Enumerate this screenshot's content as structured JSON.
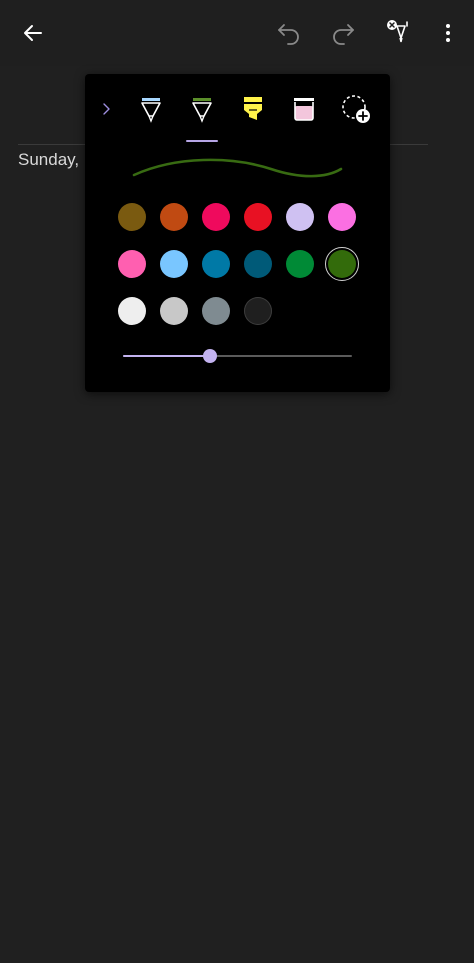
{
  "appbar": {
    "icons": [
      "back-arrow-icon",
      "undo-icon",
      "redo-icon",
      "pen-cancel-icon",
      "more-vertical-icon"
    ],
    "icon_color": "#ffffff",
    "disabled_icon_color": "#8a8a8a"
  },
  "page": {
    "date_text": "Sunday,"
  },
  "pen_popup": {
    "tools": [
      {
        "id": "pen-light-blue",
        "icon": "pen-icon",
        "color": "#a8d8ff",
        "selected": false
      },
      {
        "id": "pen-green",
        "icon": "pen-icon",
        "color": "#5b8f2a",
        "selected": true
      },
      {
        "id": "highlighter-yellow",
        "icon": "highlighter-icon",
        "color": "#fff34a",
        "selected": false
      },
      {
        "id": "marker-pink",
        "icon": "marker-icon",
        "color": "#f3c6dc",
        "selected": false
      },
      {
        "id": "add-pen",
        "icon": "add-pen-icon",
        "color": "#ffffff",
        "selected": false
      }
    ],
    "stroke_color": "#386b12",
    "colors": [
      [
        "#7a5a10",
        "#c04a12",
        "#ef0a5d",
        "#e81123",
        "#cfc1f2",
        "#fb6fe2"
      ],
      [
        "#ff5fb0",
        "#79c6ff",
        "#0079a6",
        "#005a78",
        "#008a36",
        "#336b0b"
      ],
      [
        "#eeeeee",
        "#c8c8c8",
        "#7f8b91",
        "#1f1f1f"
      ]
    ],
    "selected_color": "#336b0b",
    "thickness_fraction": 0.38
  }
}
